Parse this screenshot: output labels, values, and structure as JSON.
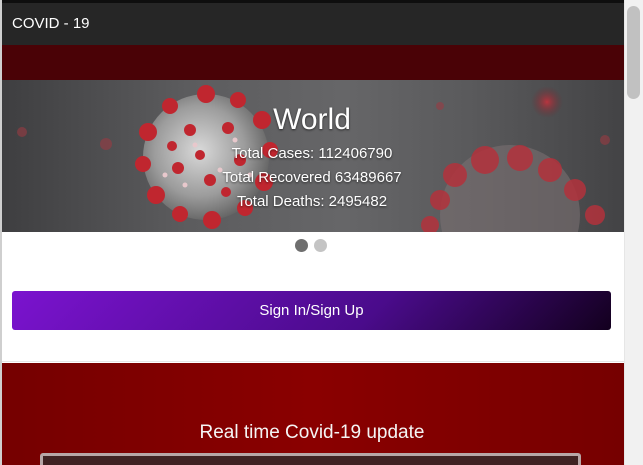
{
  "header": {
    "title": "COVID - 19"
  },
  "hero": {
    "title": "World",
    "total_cases": "Total Cases: 112406790",
    "total_recovered": "Total Recovered 63489667",
    "total_deaths": "Total Deaths: 2495482"
  },
  "carousel": {
    "slides": 2,
    "active": 1
  },
  "auth": {
    "button_label": "Sign In/Sign Up"
  },
  "update": {
    "title": "Real time Covid-19 update"
  },
  "colors": {
    "topbar": "#262626",
    "maroon": "#4a0206",
    "button_start": "#7b13cf",
    "button_end": "#13001e",
    "section_red": "#8a0000"
  }
}
